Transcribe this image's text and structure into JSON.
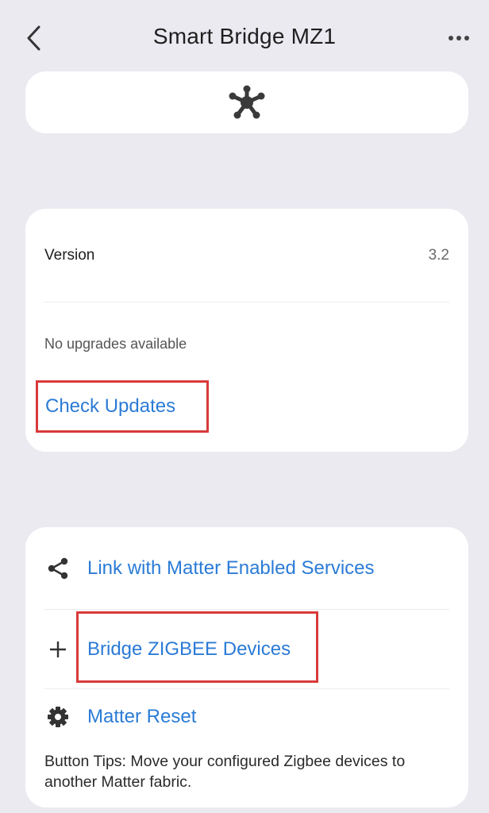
{
  "header": {
    "title": "Smart Bridge MZ1"
  },
  "version_card": {
    "version_label": "Version",
    "version_value": "3.2",
    "upgrade_status": "No upgrades available",
    "check_updates_label": "Check Updates"
  },
  "matter_card": {
    "link_label": "Link with Matter Enabled Services",
    "bridge_label": "Bridge ZIGBEE Devices",
    "reset_label": "Matter Reset",
    "tips": "Button Tips: Move your configured Zigbee devices to another Matter fabric."
  },
  "colors": {
    "background": "#ebeaf1",
    "card": "#ffffff",
    "link_blue": "#2b7bd6",
    "highlight_red": "#d93a3a"
  },
  "icons": {
    "back": "chevron-left-icon",
    "more": "more-horizontal-icon",
    "device": "hub-icon",
    "share": "share-icon",
    "add": "plus-icon",
    "reset": "gear-icon"
  }
}
